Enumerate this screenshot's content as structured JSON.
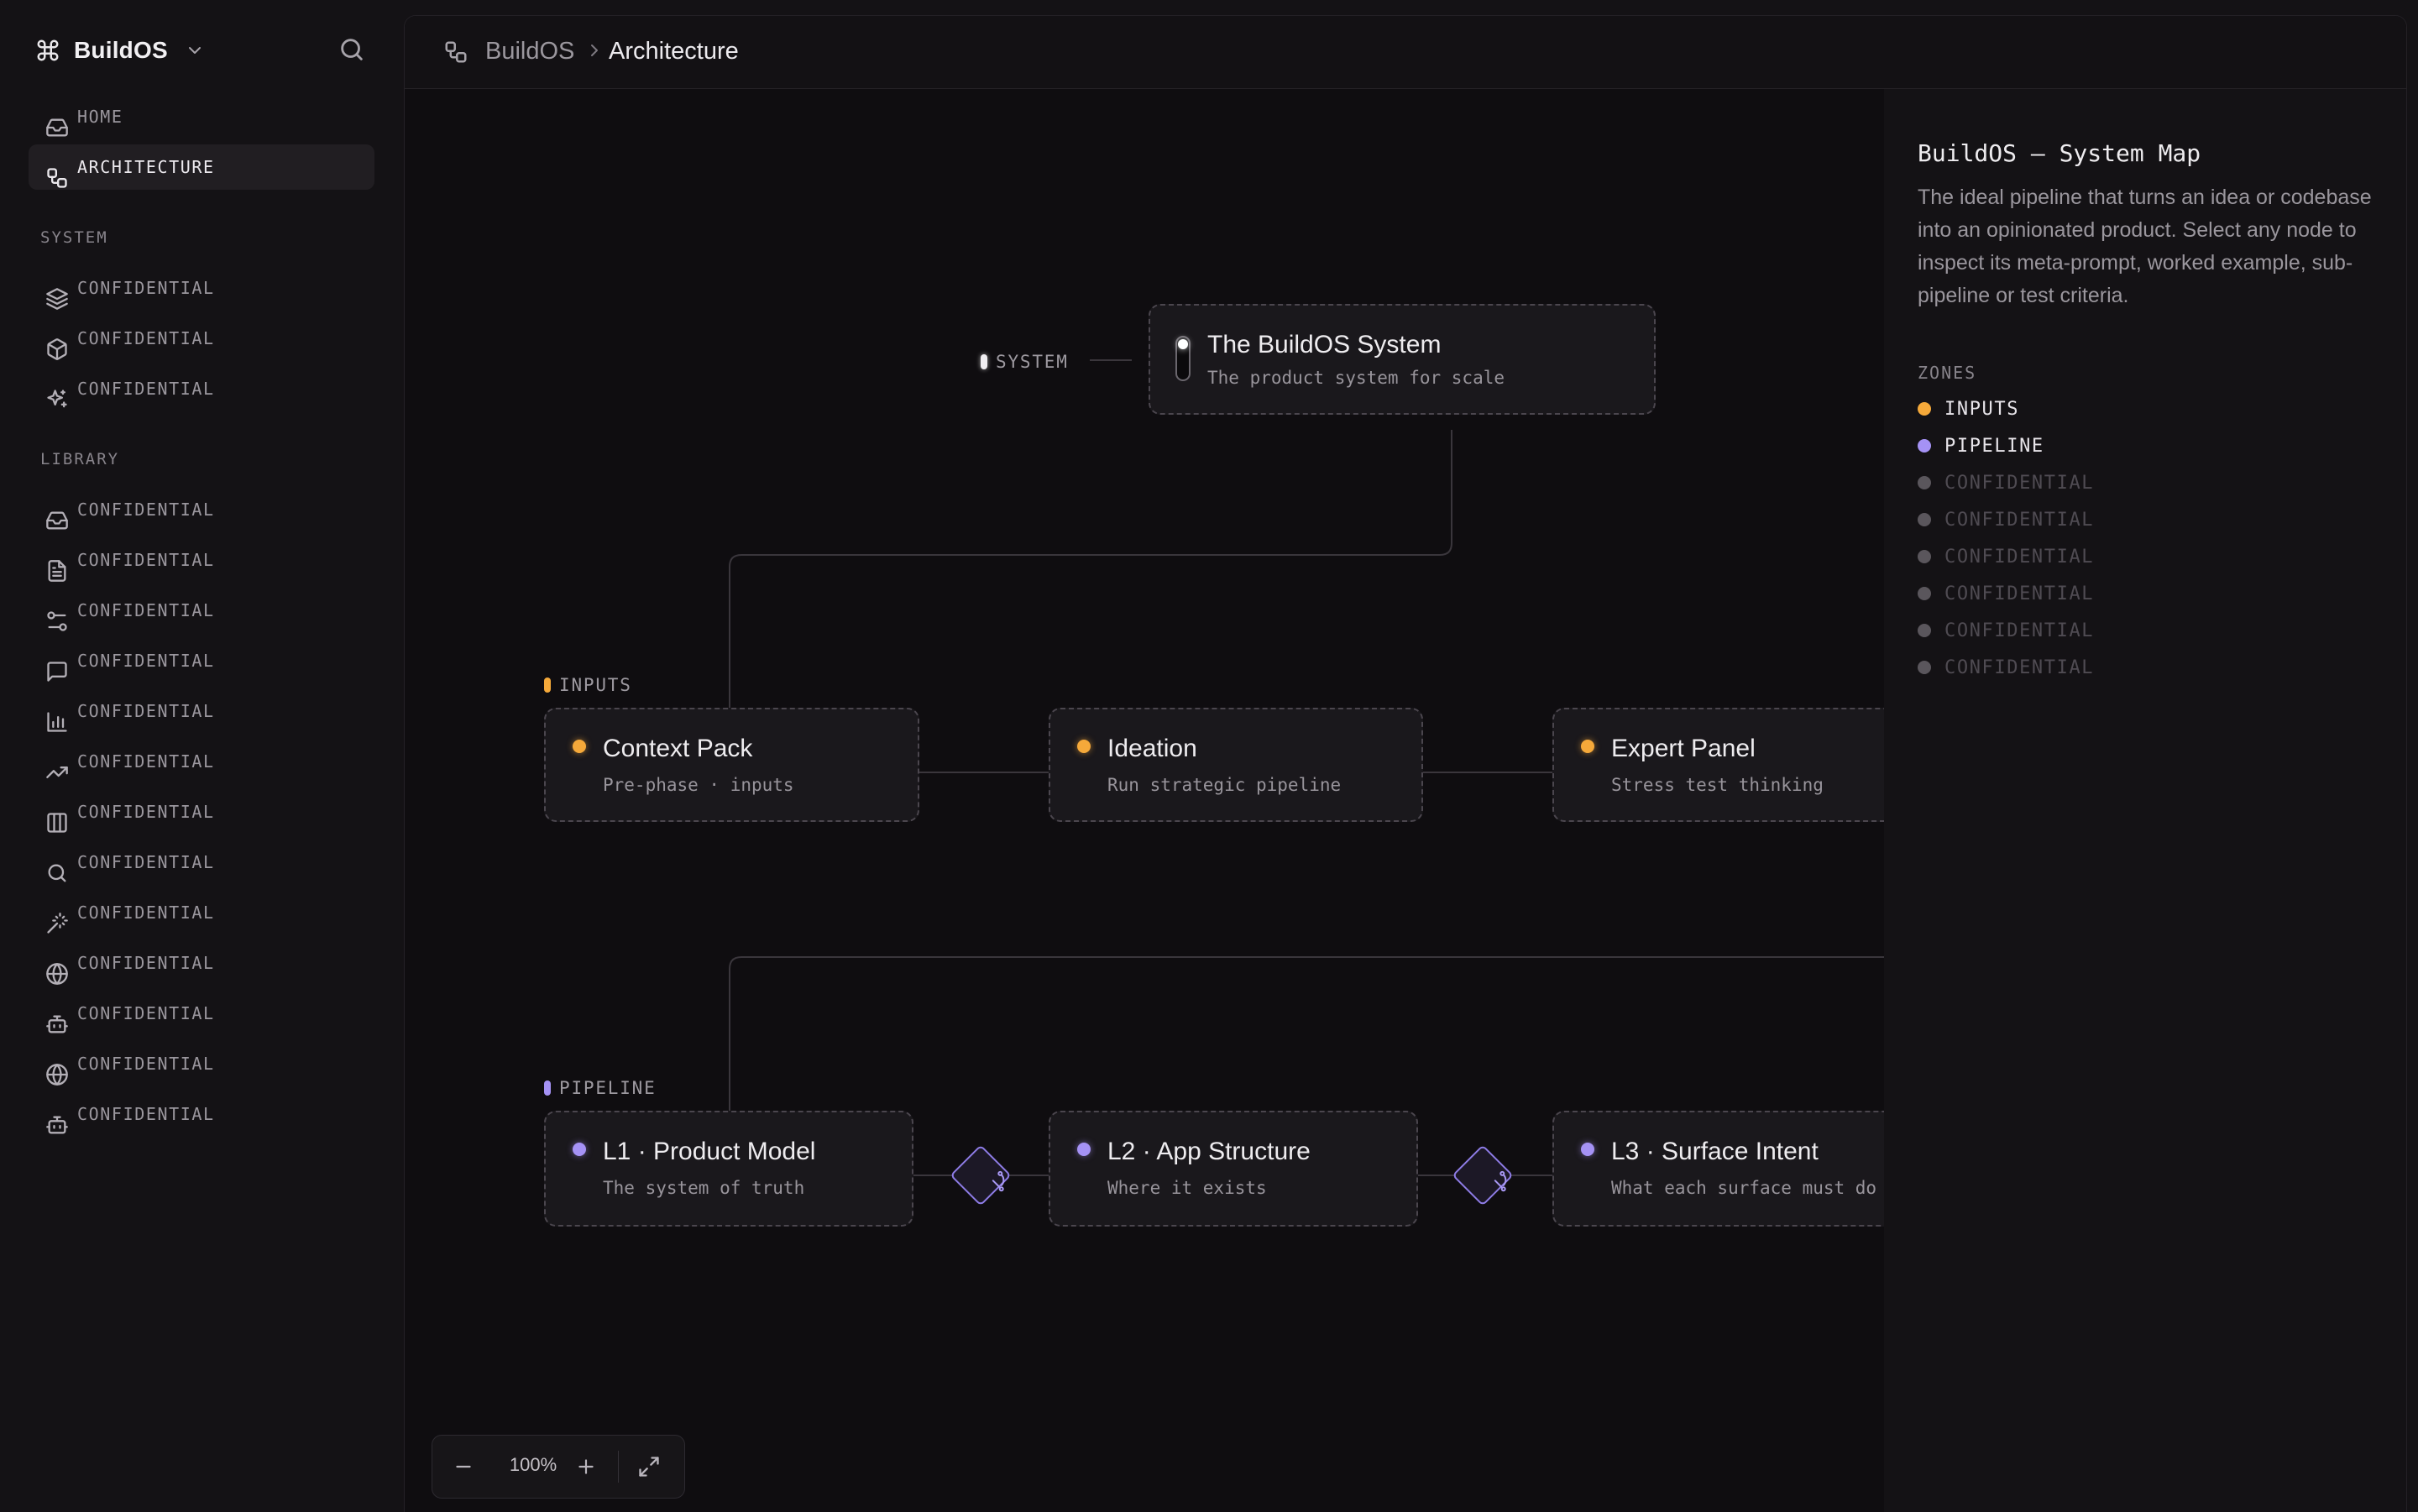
{
  "app": {
    "name": "BuildOS"
  },
  "sidebar": {
    "primary": [
      {
        "label": "HOME",
        "icon": "inbox-icon"
      },
      {
        "label": "ARCHITECTURE",
        "icon": "workflow-icon"
      }
    ],
    "system_title": "SYSTEM",
    "system": [
      {
        "label": "CONFIDENTIAL",
        "icon": "layers-icon"
      },
      {
        "label": "CONFIDENTIAL",
        "icon": "box-icon"
      },
      {
        "label": "CONFIDENTIAL",
        "icon": "sparkles-icon"
      }
    ],
    "library_title": "LIBRARY",
    "library": [
      {
        "label": "CONFIDENTIAL",
        "icon": "inbox-icon"
      },
      {
        "label": "CONFIDENTIAL",
        "icon": "file-text-icon"
      },
      {
        "label": "CONFIDENTIAL",
        "icon": "sliders-icon"
      },
      {
        "label": "CONFIDENTIAL",
        "icon": "message-square-icon"
      },
      {
        "label": "CONFIDENTIAL",
        "icon": "bar-chart-icon"
      },
      {
        "label": "CONFIDENTIAL",
        "icon": "trending-up-icon"
      },
      {
        "label": "CONFIDENTIAL",
        "icon": "columns-icon"
      },
      {
        "label": "CONFIDENTIAL",
        "icon": "search-icon"
      },
      {
        "label": "CONFIDENTIAL",
        "icon": "magic-wand-icon"
      },
      {
        "label": "CONFIDENTIAL",
        "icon": "globe-icon"
      },
      {
        "label": "CONFIDENTIAL",
        "icon": "bot-icon"
      },
      {
        "label": "CONFIDENTIAL",
        "icon": "globe-icon"
      },
      {
        "label": "CONFIDENTIAL",
        "icon": "bot-icon"
      }
    ]
  },
  "breadcrumb": {
    "root": "BuildOS",
    "current": "Architecture"
  },
  "canvas": {
    "zones": {
      "system": "SYSTEM",
      "inputs": "INPUTS",
      "pipeline": "PIPELINE"
    },
    "system_node": {
      "title": "The BuildOS System",
      "subtitle": "The product system for scale"
    },
    "input_nodes": [
      {
        "title": "Context Pack",
        "subtitle": "Pre-phase · inputs"
      },
      {
        "title": "Ideation",
        "subtitle": "Run strategic pipeline"
      },
      {
        "title": "Expert Panel",
        "subtitle": "Stress test thinking"
      }
    ],
    "pipeline_nodes": [
      {
        "title": "L1 · Product Model",
        "subtitle": "The system of truth"
      },
      {
        "title": "L2 · App Structure",
        "subtitle": "Where it exists"
      },
      {
        "title": "L3 · Surface Intent",
        "subtitle": "What each surface must do"
      }
    ],
    "zoom": "100%"
  },
  "panel": {
    "title": "BuildOS — System Map",
    "description": "The ideal pipeline that turns an idea or codebase into an opinionated product. Select any node to inspect its meta-prompt, worked example, sub-pipeline or test criteria.",
    "zones_title": "ZONES",
    "zones": [
      {
        "label": "INPUTS",
        "color": "#f5a93a"
      },
      {
        "label": "PIPELINE",
        "color": "#a592f5"
      },
      {
        "label": "CONFIDENTIAL",
        "color": "#5a565c"
      },
      {
        "label": "CONFIDENTIAL",
        "color": "#5a565c"
      },
      {
        "label": "CONFIDENTIAL",
        "color": "#5a565c"
      },
      {
        "label": "CONFIDENTIAL",
        "color": "#5a565c"
      },
      {
        "label": "CONFIDENTIAL",
        "color": "#5a565c"
      },
      {
        "label": "CONFIDENTIAL",
        "color": "#5a565c"
      }
    ]
  },
  "colors": {
    "inputs": "#f5a93a",
    "pipeline": "#a592f5",
    "background": "#0f0d10"
  }
}
